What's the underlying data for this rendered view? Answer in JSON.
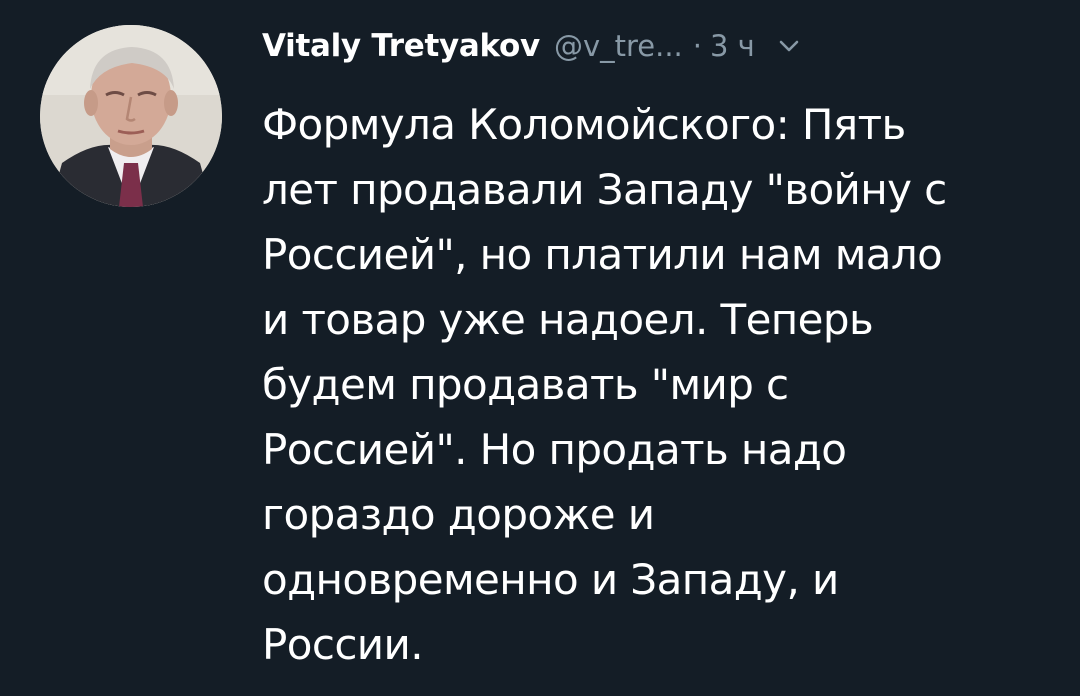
{
  "tweet": {
    "author": {
      "name": "Vitaly Tretyakov",
      "handle": "@v_tre...",
      "avatar": "avatar-photo"
    },
    "separator": "·",
    "time": "3 ч",
    "menu_icon": "chevron-down-icon",
    "text": "Формула Коломойского: Пять\nлет продавали Западу \"войну с\nРоссией\", но платили нам мало\nи товар уже надоел. Теперь\nбудем продавать \"мир с\nРоссией\". Но продать надо\nгораздо дороже и\nодновременно и Западу, и\nРоссии."
  },
  "colors": {
    "background": "#141d26",
    "text": "#ffffff",
    "muted": "#8899a6"
  }
}
